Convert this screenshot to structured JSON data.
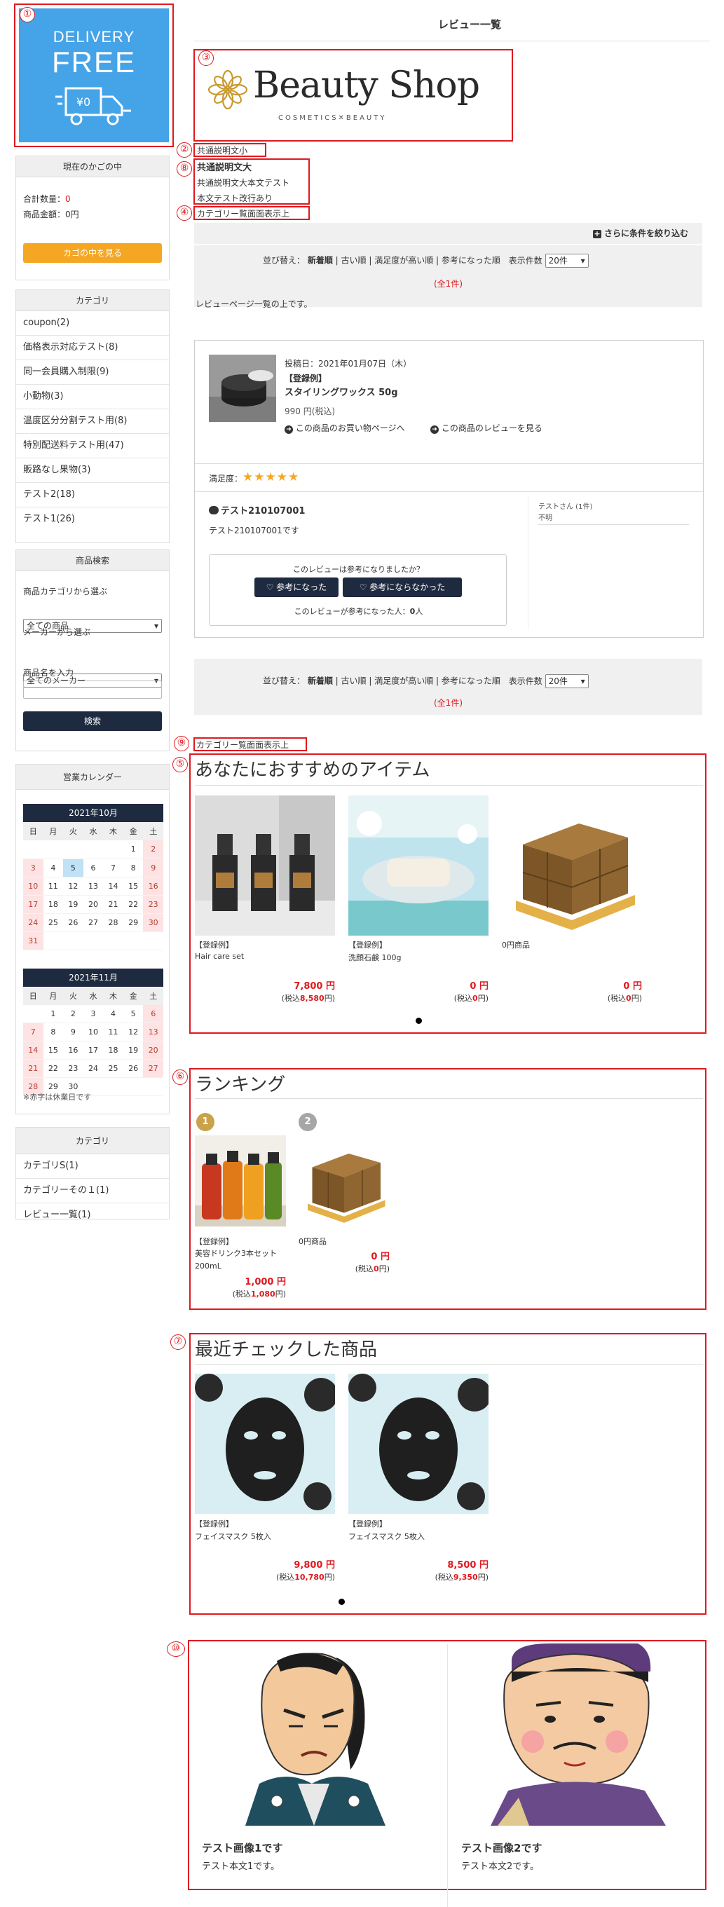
{
  "page_title": "レビュー一覧",
  "annotations": [
    "①",
    "②",
    "③",
    "④",
    "⑤",
    "⑥",
    "⑦",
    "⑧",
    "⑨",
    "⑩"
  ],
  "banner": {
    "line1": "DELIVERY",
    "line2": "FREE",
    "yen": "¥0"
  },
  "logo": {
    "main": "Beauty Shop",
    "sub": "COSMETICS✕BEAUTY"
  },
  "texts": {
    "common_small": "共通説明文小",
    "common_large_title": "共通説明文大",
    "common_large_body1": "共通説明文大本文テスト",
    "common_large_body2": "本文テスト改行あり",
    "category_top_display": "カテゴリー覧面面表示上",
    "category_top_display2": "カテゴリー覧面面表示上",
    "review_page_top": "レビューページ一覧の上です。"
  },
  "cart": {
    "title": "現在のかごの中",
    "count_label": "合計数量：",
    "count_value": "0",
    "amount_label": "商品金額：0円",
    "button": "カゴの中を見る"
  },
  "category_box": {
    "title": "カテゴリ",
    "items": [
      "coupon(2)",
      "価格表示対応テスト(8)",
      "同一会員購入制限(9)",
      "小動物(3)",
      "温度区分分割テスト用(8)",
      "特別配送料テスト用(47)",
      "販路なし果物(3)",
      "テスト2(18)",
      "テスト1(26)"
    ]
  },
  "search_box": {
    "title": "商品検索",
    "cat_label": "商品カテゴリから選ぶ",
    "cat_value": "全ての商品",
    "maker_label": "メーカーから選ぶ",
    "maker_value": "全てのメーカー",
    "name_label": "商品名を入力",
    "button": "検索"
  },
  "calendar": {
    "title": "営業カレンダー",
    "weekdays": [
      "日",
      "月",
      "火",
      "水",
      "木",
      "金",
      "土"
    ],
    "months": [
      {
        "label": "2021年10月",
        "weeks": [
          [
            "",
            "",
            "",
            "",
            "",
            "1",
            "2"
          ],
          [
            "3",
            "4",
            "5",
            "6",
            "7",
            "8",
            "9"
          ],
          [
            "10",
            "11",
            "12",
            "13",
            "14",
            "15",
            "16"
          ],
          [
            "17",
            "18",
            "19",
            "20",
            "21",
            "22",
            "23"
          ],
          [
            "24",
            "25",
            "26",
            "27",
            "28",
            "29",
            "30"
          ],
          [
            "31",
            "",
            "",
            "",
            "",
            "",
            ""
          ]
        ]
      },
      {
        "label": "2021年11月",
        "weeks": [
          [
            "",
            "1",
            "2",
            "3",
            "4",
            "5",
            "6"
          ],
          [
            "7",
            "8",
            "9",
            "10",
            "11",
            "12",
            "13"
          ],
          [
            "14",
            "15",
            "16",
            "17",
            "18",
            "19",
            "20"
          ],
          [
            "21",
            "22",
            "23",
            "24",
            "25",
            "26",
            "27"
          ],
          [
            "28",
            "29",
            "30",
            "",
            "",
            "",
            ""
          ]
        ]
      }
    ],
    "today": "5",
    "note": "※赤字は休業日です"
  },
  "category_box2": {
    "title": "カテゴリ",
    "items": [
      "カテゴリS(1)",
      "カテゴリーその１(1)",
      "レビュー一覧(1)"
    ]
  },
  "filter": {
    "label": "さらに条件を絞り込む"
  },
  "sort": {
    "label": "並び替え：",
    "options": [
      "新着順",
      "古い順",
      "満足度が高い順",
      "参考になった順"
    ],
    "count_label": "表示件数",
    "count_value": "20件",
    "total": "(全1件)"
  },
  "review": {
    "date": "投稿日：2021年01月07日（木）",
    "tag": "【登録例】",
    "product": "スタイリングワックス 50g",
    "price": "990 円(税込)",
    "link1": "この商品のお買い物ページへ",
    "link2": "この商品のレビューを見る",
    "rating_label": "満足度：",
    "stars": "★★★★★",
    "rating_value": 5,
    "title": "テスト210107001",
    "body": "テスト210107001です",
    "reviewer": "テストさん (1件)",
    "reviewer_info": "不明",
    "helpful_q": "このレビューは参考になりましたか？",
    "yes": "参考になった",
    "no": "参考にならなかった",
    "helpful_count_label": "このレビューが参考になった人：",
    "helpful_count": "0",
    "helpful_unit": "人"
  },
  "recommend": {
    "title": "あなたにおすすめのアイテム",
    "items": [
      {
        "tag": "【登録例】",
        "name": "Hair care set",
        "price": "7,800 円",
        "tax_prefix": "(税込",
        "tax_value": "8,580",
        "tax_suffix": "円)"
      },
      {
        "tag": "【登録例】",
        "name": "洗顔石鹸 100g",
        "price": "0 円",
        "tax_prefix": "(税込",
        "tax_value": "0",
        "tax_suffix": "円)"
      },
      {
        "tag": "",
        "name": "0円商品",
        "price": "0 円",
        "tax_prefix": "(税込",
        "tax_value": "0",
        "tax_suffix": "円)"
      }
    ]
  },
  "ranking": {
    "title": "ランキング",
    "items": [
      {
        "rank": "1",
        "tag": "【登録例】",
        "name": "美容ドリンク3本セット 200mL",
        "price": "1,000 円",
        "tax_prefix": "(税込",
        "tax_value": "1,080",
        "tax_suffix": "円)"
      },
      {
        "rank": "2",
        "tag": "",
        "name": "0円商品",
        "price": "0 円",
        "tax_prefix": "(税込",
        "tax_value": "0",
        "tax_suffix": "円)"
      }
    ]
  },
  "recent": {
    "title": "最近チェックした商品",
    "items": [
      {
        "tag": "【登録例】",
        "name": "フェイスマスク 5枚入",
        "price": "9,800 円",
        "tax_prefix": "(税込",
        "tax_value": "10,780",
        "tax_suffix": "円)"
      },
      {
        "tag": "【登録例】",
        "name": "フェイスマスク 5枚入",
        "price": "8,500 円",
        "tax_prefix": "(税込",
        "tax_value": "9,350",
        "tax_suffix": "円)"
      }
    ]
  },
  "bottom": {
    "items": [
      {
        "title": "テスト画像1です",
        "body": "テスト本文1です。"
      },
      {
        "title": "テスト画像2です",
        "body": "テスト本文2です。"
      }
    ]
  },
  "colors": {
    "accent_red": "#e0191f",
    "banner_blue": "#45a3e8",
    "dark_button": "#1e2a3f",
    "orange_button": "#f5a623"
  }
}
